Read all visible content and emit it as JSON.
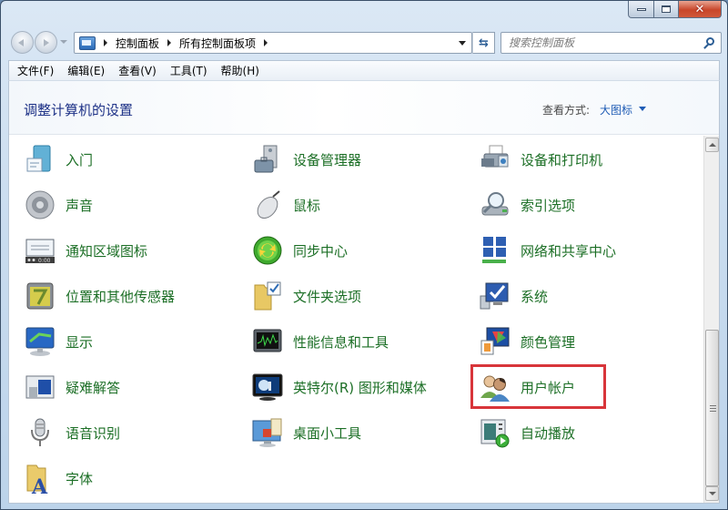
{
  "window": {
    "caption_buttons": [
      "minimize",
      "maximize",
      "close"
    ]
  },
  "nav": {
    "back_icon": "back-arrow-icon",
    "forward_icon": "forward-arrow-icon",
    "address_icon": "control-panel-icon",
    "breadcrumb": [
      "控制面板",
      "所有控制面板项"
    ],
    "refresh_icon": "refresh-icon",
    "search_placeholder": "搜索控制面板",
    "search_value": ""
  },
  "menubar": [
    "文件(F)",
    "编辑(E)",
    "查看(V)",
    "工具(T)",
    "帮助(H)"
  ],
  "header": {
    "title": "调整计算机的设置",
    "view_by_label": "查看方式:",
    "view_by_value": "大图标"
  },
  "items": [
    {
      "label": "入门",
      "icon": "getting-started-icon"
    },
    {
      "label": "设备管理器",
      "icon": "device-manager-icon"
    },
    {
      "label": "设备和打印机",
      "icon": "devices-printers-icon"
    },
    {
      "label": "声音",
      "icon": "speaker-icon"
    },
    {
      "label": "鼠标",
      "icon": "mouse-icon"
    },
    {
      "label": "索引选项",
      "icon": "indexing-options-icon"
    },
    {
      "label": "通知区域图标",
      "icon": "notification-area-icon"
    },
    {
      "label": "同步中心",
      "icon": "sync-center-icon"
    },
    {
      "label": "网络和共享中心",
      "icon": "network-sharing-icon"
    },
    {
      "label": "位置和其他传感器",
      "icon": "location-sensors-icon"
    },
    {
      "label": "文件夹选项",
      "icon": "folder-options-icon"
    },
    {
      "label": "系统",
      "icon": "system-icon"
    },
    {
      "label": "显示",
      "icon": "display-icon"
    },
    {
      "label": "性能信息和工具",
      "icon": "performance-icon"
    },
    {
      "label": "颜色管理",
      "icon": "color-management-icon"
    },
    {
      "label": "疑难解答",
      "icon": "troubleshooting-icon"
    },
    {
      "label": "英特尔(R) 图形和媒体",
      "icon": "intel-graphics-icon"
    },
    {
      "label": "用户帐户",
      "icon": "user-accounts-icon",
      "highlighted": true
    },
    {
      "label": "语音识别",
      "icon": "microphone-icon"
    },
    {
      "label": "桌面小工具",
      "icon": "desktop-gadgets-icon"
    },
    {
      "label": "自动播放",
      "icon": "autoplay-icon"
    },
    {
      "label": "字体",
      "icon": "fonts-icon"
    }
  ],
  "highlight_color": "#d8353a",
  "label_color": "#1c6f26",
  "scrollbar": {
    "position_fraction": 1.0,
    "visible_fraction": 0.47
  }
}
